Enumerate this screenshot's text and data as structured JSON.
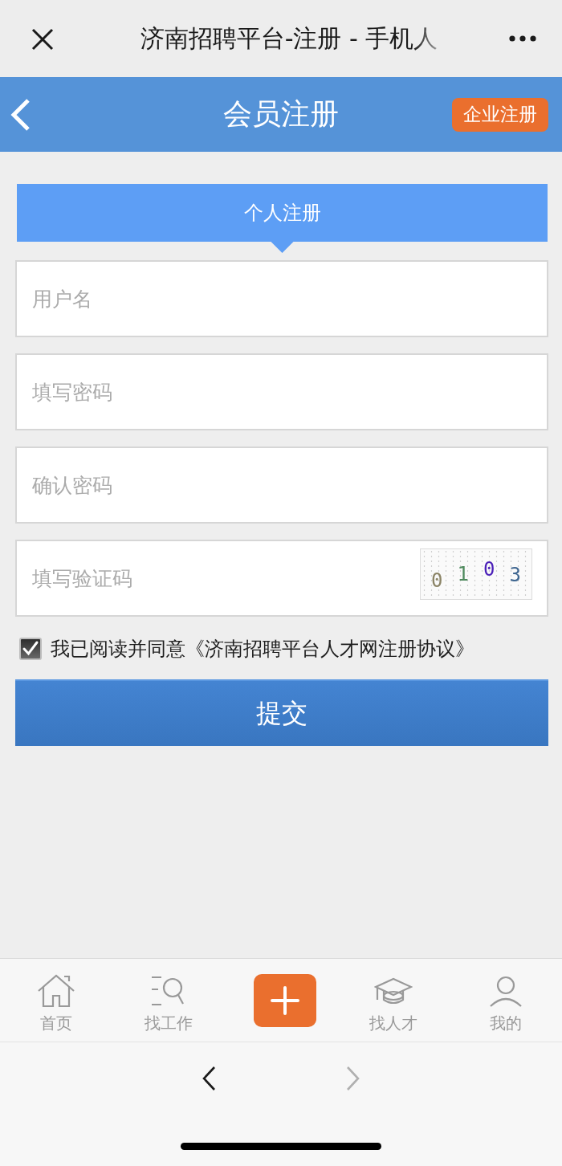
{
  "browser_bar": {
    "title": "济南招聘平台-注册 - 手机人"
  },
  "header": {
    "title": "会员注册",
    "action": "企业注册"
  },
  "tabs": [
    {
      "label": "个人注册",
      "selected": true
    }
  ],
  "form": {
    "fields": [
      {
        "kind": "text",
        "placeholder": "用户名"
      },
      {
        "kind": "password",
        "placeholder": "填写密码"
      },
      {
        "kind": "password",
        "placeholder": "确认密码"
      },
      {
        "kind": "captcha",
        "placeholder": "填写验证码",
        "captcha": [
          {
            "text": "0",
            "color": "#8b8466"
          },
          {
            "text": "1",
            "color": "#4f8a5e"
          },
          {
            "text": "0",
            "color": "#4a1fb8"
          },
          {
            "text": "3",
            "color": "#3f6690"
          }
        ]
      }
    ],
    "agreement": {
      "checked": true,
      "text": "我已阅读并同意《济南招聘平台人才网注册协议》"
    },
    "submit": "提交"
  },
  "bottom_nav": [
    {
      "kind": "tab",
      "label": "首页"
    },
    {
      "kind": "tab",
      "label": "找工作"
    },
    {
      "kind": "add"
    },
    {
      "kind": "tab",
      "label": "找人才"
    },
    {
      "kind": "tab",
      "label": "我的"
    }
  ],
  "browser_nav": [
    {
      "disabled": false
    },
    {
      "disabled": true
    }
  ]
}
